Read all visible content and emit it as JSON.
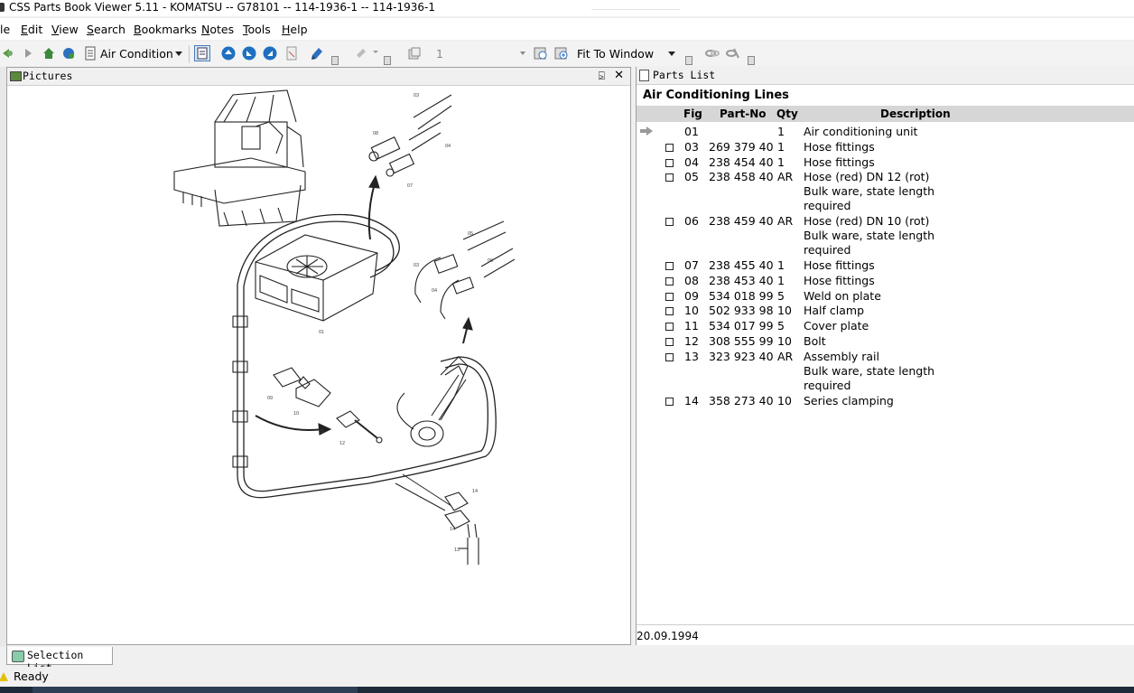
{
  "window": {
    "title": "CSS Parts Book Viewer 5.11 - KOMATSU -- G78101 -- 114-1936-1 -- 114-1936-1"
  },
  "menu": [
    {
      "label": "le",
      "ul": ""
    },
    {
      "label": "Edit",
      "ul": "E"
    },
    {
      "label": "View",
      "ul": "V"
    },
    {
      "label": "Search",
      "ul": "S"
    },
    {
      "label": "Bookmarks",
      "ul": "B"
    },
    {
      "label": "Notes",
      "ul": "N"
    },
    {
      "label": "Tools",
      "ul": "T"
    },
    {
      "label": "Help",
      "ul": "H"
    }
  ],
  "toolbar": {
    "section_combo": "Air Condition",
    "page_number": "1",
    "zoom_combo": "Fit To Window"
  },
  "pictures_panel": {
    "title": "Pictures",
    "pin_glyph": "⍄",
    "close_glyph": "✕"
  },
  "parts_panel": {
    "title": "Parts List",
    "section_title": "Air Conditioning Lines",
    "columns": {
      "fig": "Fig",
      "part_no": "Part-No",
      "qty": "Qty",
      "description": "Description"
    },
    "rows": [
      {
        "fig": "01",
        "part_no": "",
        "qty": "1",
        "description": "Air conditioning unit",
        "lines": 1,
        "current": true
      },
      {
        "fig": "03",
        "part_no": "269 379 40",
        "qty": "1",
        "description": "Hose fittings",
        "lines": 1
      },
      {
        "fig": "04",
        "part_no": "238 454 40",
        "qty": "1",
        "description": "Hose fittings",
        "lines": 1
      },
      {
        "fig": "05",
        "part_no": "238 458 40",
        "qty": "AR",
        "description": "Hose (red) DN 12 (rot)\nBulk ware, state length\nrequired",
        "lines": 3
      },
      {
        "fig": "06",
        "part_no": "238 459 40",
        "qty": "AR",
        "description": "Hose (red) DN 10 (rot)\nBulk ware, state length\nrequired",
        "lines": 3
      },
      {
        "fig": "07",
        "part_no": "238 455 40",
        "qty": "1",
        "description": "Hose fittings",
        "lines": 1
      },
      {
        "fig": "08",
        "part_no": "238 453 40",
        "qty": "1",
        "description": "Hose fittings",
        "lines": 1
      },
      {
        "fig": "09",
        "part_no": "534 018 99",
        "qty": "5",
        "description": "Weld on plate",
        "lines": 1
      },
      {
        "fig": "10",
        "part_no": "502 933 98",
        "qty": "10",
        "description": "Half clamp",
        "lines": 1
      },
      {
        "fig": "11",
        "part_no": "534 017 99",
        "qty": "5",
        "description": "Cover plate",
        "lines": 1
      },
      {
        "fig": "12",
        "part_no": "308 555 99",
        "qty": "10",
        "description": "Bolt",
        "lines": 1
      },
      {
        "fig": "13",
        "part_no": "323 923 40",
        "qty": "AR",
        "description": "Assembly rail\nBulk ware, state length\nrequired",
        "lines": 3
      },
      {
        "fig": "14",
        "part_no": "358 273 40",
        "qty": "10",
        "description": "Series clamping",
        "lines": 1
      }
    ],
    "date": "20.09.1994"
  },
  "drawing_labels": [
    "03",
    "08",
    "04",
    "07",
    "05",
    "06",
    "03",
    "04",
    "01",
    "09",
    "10",
    "11",
    "12",
    "14",
    "14",
    "13"
  ],
  "selection_tab": {
    "title": "Selection List"
  },
  "status": {
    "text": "Ready"
  },
  "colors": {
    "header_bg": "#d6d6d6",
    "toolbar_blue": "#1f6fc0",
    "taskbar": "#1c2a3a"
  }
}
